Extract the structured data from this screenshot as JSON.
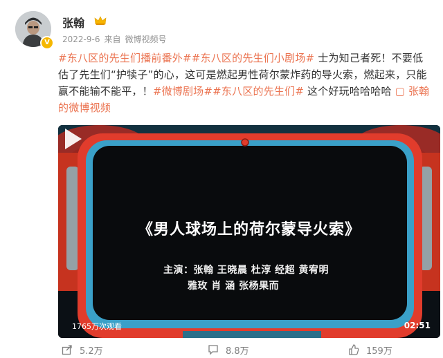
{
  "user": {
    "name": "张翰",
    "verified_badge": "V"
  },
  "post": {
    "date": "2022-9-6",
    "from": "来自",
    "source": "微博视频号",
    "segments": [
      {
        "text": "#东八区的先生们播前番外#",
        "type": "tag"
      },
      {
        "text": "#东八区的先生们小剧场#",
        "type": "tag"
      },
      {
        "text": " 士为知己者死！不要低估了先生们“护犊子”的心，这可是燃起男性荷尔蒙炸药的导火索，燃起来，只能赢不能输不能平，！",
        "type": "plain"
      },
      {
        "text": "#微博剧场#",
        "type": "tag"
      },
      {
        "text": "#东八区的先生们#",
        "type": "tag"
      },
      {
        "text": " 这个好玩哈哈哈哈 ",
        "type": "plain"
      },
      {
        "text": "张翰的微博视频",
        "type": "link"
      }
    ]
  },
  "video": {
    "title": "《男人球场上的荷尔蒙导火索》",
    "cast_line1": "主演：张翰  王晓晨 杜淳  经超   黄宥明",
    "cast_line2": "雅玫  肖    涵 张杨果而",
    "views": "1765万次观看",
    "duration": "02:51"
  },
  "actions": {
    "share": "5.2万",
    "comment": "8.8万",
    "like": "159万"
  },
  "colors": {
    "accent": "#eb7350",
    "meta": "#939393",
    "tv_red": "#d93a2b",
    "tv_blue": "#3aa0c8"
  }
}
